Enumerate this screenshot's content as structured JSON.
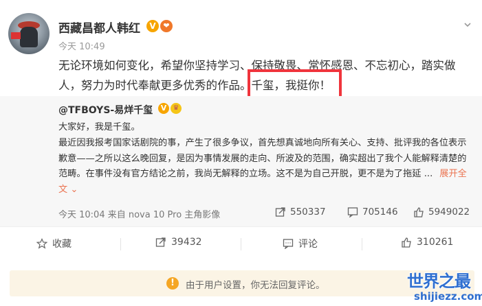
{
  "post": {
    "author": "西藏昌都人韩红",
    "verified_badge": "V",
    "timestamp": "今天 10:49",
    "text": "无论环境如何变化，希望你坚持学习、保持敬畏、常怀感恩、不忘初心，踏实做人，努力为时代奉献更多优秀的作品。千玺，我挺你！"
  },
  "repost": {
    "author": "@TFBOYS-易烊千玺",
    "verified_badge": "V",
    "text": "大家好，我是千玺。\n最近因我报考国家话剧院的事，产生了很多争议，首先想真诚地向所有关心、支持、批评我的各位表示歉意——之所以这么晚回复，是因为事情发展的走向、所波及的范围，确实超出了我个人能解释清楚的范畴。在事件没有官方结论之前，我尚无解释的立场。这不是为自己开脱，更不是为了拖延 ...",
    "expand_label": "展开全文",
    "meta": "今天 10:04 来自 nova 10 Pro 主角影像",
    "reposts": "550337",
    "comments": "705146",
    "likes": "5949022"
  },
  "actions": {
    "favorite": "收藏",
    "repost": "39432",
    "comment": "评论",
    "like": "310261"
  },
  "notice": {
    "text": "由于用户设置，你无法回复评论。"
  },
  "watermark": {
    "title": "世界之最",
    "url": "shijiezz.com"
  },
  "colors": {
    "highlight_border": "#f0343c",
    "link_orange": "#eb7350",
    "notice_bg": "#fbf4e5",
    "watermark_blue": "#2f6fd0"
  }
}
